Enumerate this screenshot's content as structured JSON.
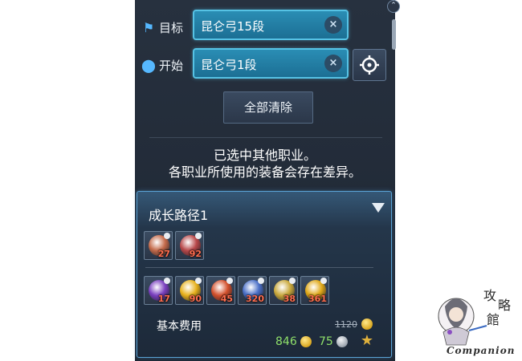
{
  "route": {
    "target": {
      "label": "目标",
      "value": "昆仑弓15段",
      "icon": "flag-icon"
    },
    "start": {
      "label": "开始",
      "value": "昆仑弓1段",
      "icon": "map-pin-icon"
    },
    "clear_icon": "×",
    "locate_icon": "crosshair-icon",
    "clear_all_label": "全部清除"
  },
  "notice": {
    "line1": "已选中其他职业。",
    "line2": "各职业所使用的装备会存在差异。"
  },
  "growth_path": {
    "title": "成长路径1",
    "row1": [
      {
        "count": "27",
        "color": "#c46a4a"
      },
      {
        "count": "92",
        "color": "#b8484a"
      }
    ],
    "row2": [
      {
        "count": "17",
        "color": "#7a3fbf"
      },
      {
        "count": "90",
        "color": "#e7b11c"
      },
      {
        "count": "45",
        "color": "#d3502c"
      },
      {
        "count": "320",
        "color": "#4a6fc7"
      },
      {
        "count": "38",
        "color": "#c9a83b"
      },
      {
        "count": "361",
        "color": "#e0a817"
      }
    ],
    "cost_label": "基本费用",
    "original_cost": "1120",
    "gold_cost": "846",
    "silver_cost": "75"
  },
  "watermark": {
    "text": "Companion",
    "glyphs": "攻略館"
  }
}
